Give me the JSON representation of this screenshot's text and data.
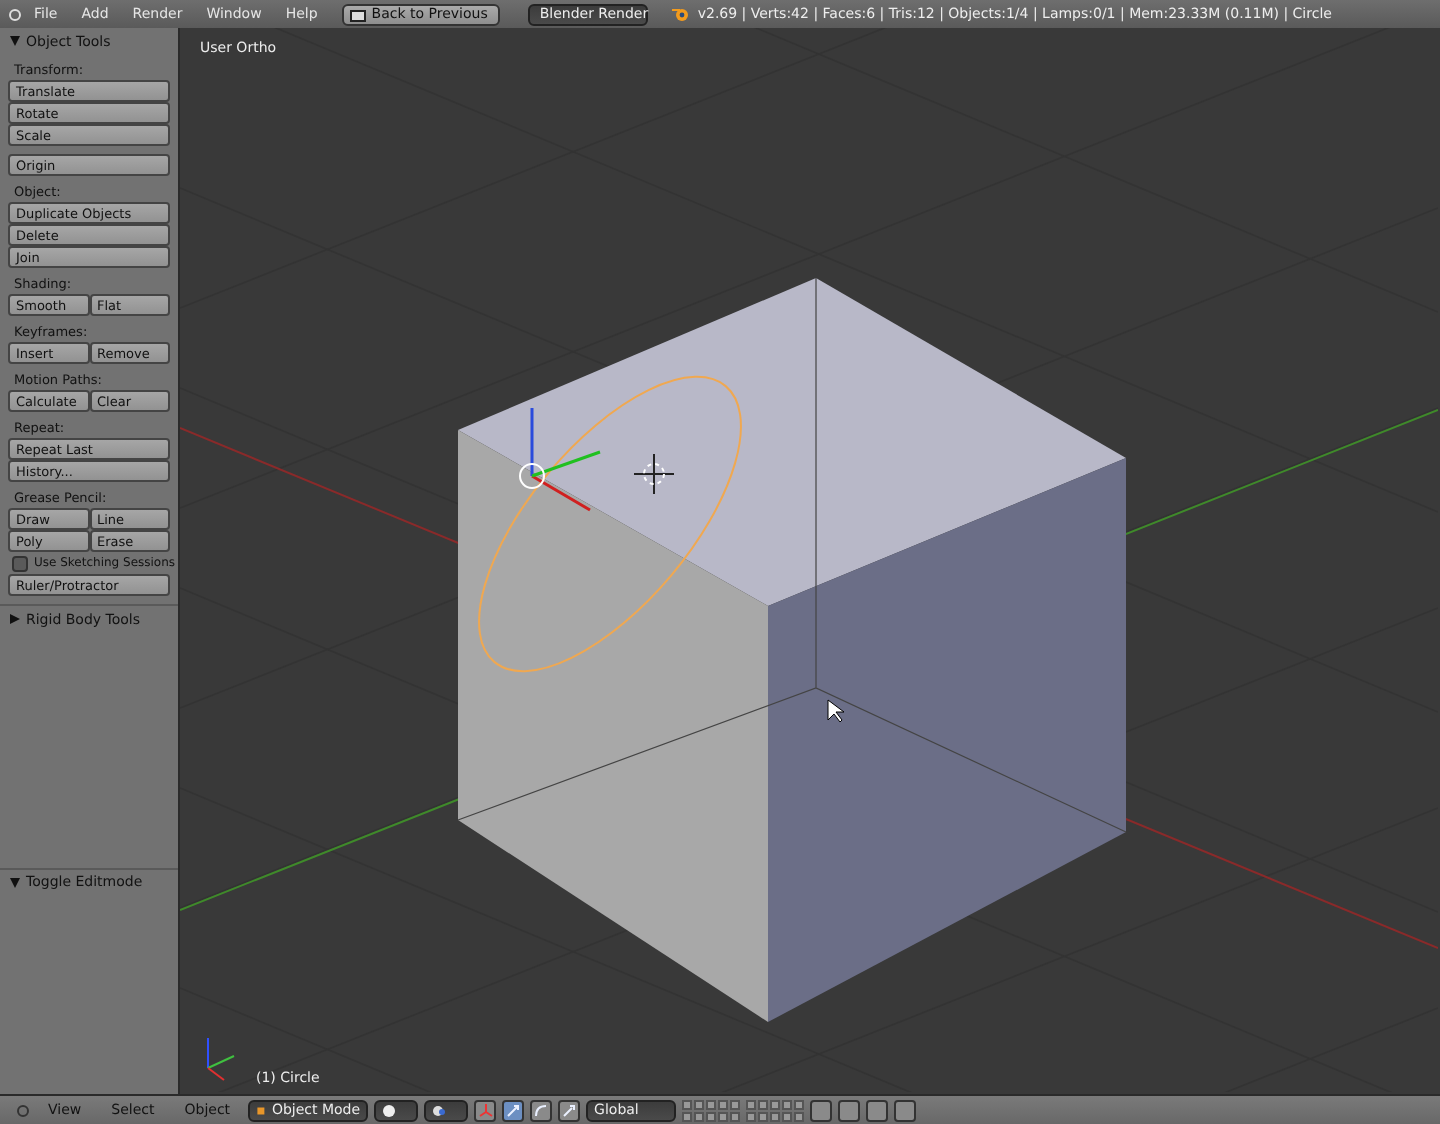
{
  "menu_bar": {
    "menus": [
      "File",
      "Add",
      "Render",
      "Window",
      "Help"
    ],
    "back_button": "Back to Previous",
    "render_engine": "Blender Render",
    "stats": "v2.69 | Verts:42 | Faces:6 | Tris:12 | Objects:1/4 | Lamps:0/1 | Mem:23.33M (0.11M) | Circle"
  },
  "tool_panel": {
    "title": "Object Tools",
    "expanded": true,
    "sections": [
      {
        "label": "Transform:",
        "items": [
          {
            "kind": "buttons",
            "labels": [
              "Translate"
            ]
          },
          {
            "kind": "buttons",
            "labels": [
              "Rotate"
            ]
          },
          {
            "kind": "buttons",
            "labels": [
              "Scale"
            ]
          }
        ]
      },
      {
        "items": [
          {
            "kind": "buttons",
            "labels": [
              "Origin"
            ]
          }
        ]
      },
      {
        "label": "Object:",
        "items": [
          {
            "kind": "buttons",
            "labels": [
              "Duplicate Objects"
            ]
          },
          {
            "kind": "buttons",
            "labels": [
              "Delete"
            ]
          },
          {
            "kind": "buttons",
            "labels": [
              "Join"
            ]
          }
        ]
      },
      {
        "label": "Shading:",
        "items": [
          {
            "kind": "buttons",
            "labels": [
              "Smooth",
              "Flat"
            ]
          }
        ]
      },
      {
        "label": "Keyframes:",
        "items": [
          {
            "kind": "buttons",
            "labels": [
              "Insert",
              "Remove"
            ]
          }
        ]
      },
      {
        "label": "Motion Paths:",
        "items": [
          {
            "kind": "buttons",
            "labels": [
              "Calculate",
              "Clear"
            ]
          }
        ]
      },
      {
        "label": "Repeat:",
        "items": [
          {
            "kind": "buttons",
            "labels": [
              "Repeat Last"
            ]
          },
          {
            "kind": "buttons",
            "labels": [
              "History..."
            ]
          }
        ]
      },
      {
        "label": "Grease Pencil:",
        "items": [
          {
            "kind": "buttons",
            "labels": [
              "Draw",
              "Line"
            ]
          },
          {
            "kind": "buttons",
            "labels": [
              "Poly",
              "Erase"
            ]
          },
          {
            "kind": "checkbox",
            "label": "Use Sketching Sessions",
            "checked": false
          },
          {
            "kind": "buttons",
            "labels": [
              "Ruler/Protractor"
            ]
          }
        ]
      }
    ]
  },
  "rigid_body_panel": {
    "title": "Rigid Body Tools",
    "expanded": false
  },
  "operator_panel": {
    "title": "Toggle Editmode",
    "expanded": true
  },
  "viewport": {
    "view_label": "User Ortho",
    "object_label": "(1) Circle"
  },
  "header": {
    "menus": [
      "View",
      "Select",
      "Object"
    ],
    "mode": "Object Mode",
    "manipulators": [
      {
        "selected": true
      },
      {
        "selected": false
      },
      {
        "selected": false
      }
    ],
    "orientation": "Global"
  }
}
